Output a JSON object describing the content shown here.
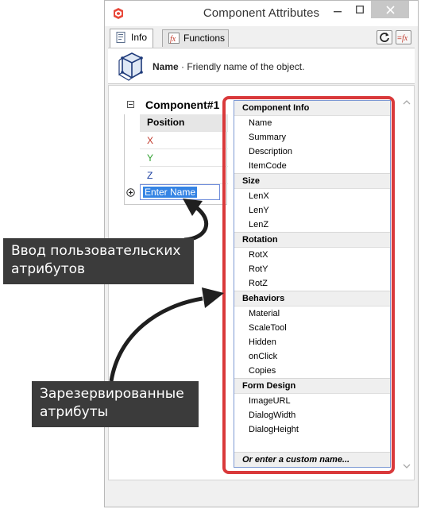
{
  "window": {
    "title": "Component Attributes",
    "close_symbol": "×"
  },
  "tabs": [
    {
      "label": "Info",
      "icon": "info-icon",
      "active": true
    },
    {
      "label": "Functions",
      "icon": "fx-icon",
      "active": false
    }
  ],
  "toolbar": {
    "refresh_icon": "refresh-icon",
    "fx_icon": "fx-icon"
  },
  "info": {
    "name_label": "Name",
    "description": " · Friendly name of the object."
  },
  "component": {
    "title": "Component#1",
    "header": "Position",
    "rows": [
      {
        "label": "X"
      },
      {
        "label": "Y"
      },
      {
        "label": "Z"
      }
    ],
    "input_value": "Enter Name"
  },
  "dropdown": {
    "sections": [
      {
        "title": "Component Info",
        "items": [
          "Name",
          "Summary",
          "Description",
          "ItemCode"
        ]
      },
      {
        "title": "Size",
        "items": [
          "LenX",
          "LenY",
          "LenZ"
        ]
      },
      {
        "title": "Rotation",
        "items": [
          "RotX",
          "RotY",
          "RotZ"
        ]
      },
      {
        "title": "Behaviors",
        "items": [
          "Material",
          "ScaleTool",
          "Hidden",
          "onClick",
          "Copies"
        ]
      },
      {
        "title": "Form Design",
        "items": [
          "ImageURL",
          "DialogWidth",
          "DialogHeight"
        ]
      }
    ],
    "footer": "Or enter a custom name..."
  },
  "annotations": {
    "user_attributes": "Ввод пользовательских\nатрибутов",
    "reserved_attributes": "Зарезервированные\nатрибуты"
  },
  "colors": {
    "highlight_frame": "#d9393b",
    "callout_bg": "#3b3b3b",
    "x_axis": "#c0392b",
    "y_axis": "#2e9f2e",
    "z_axis": "#1b3fa0",
    "selection": "#3584e4"
  }
}
